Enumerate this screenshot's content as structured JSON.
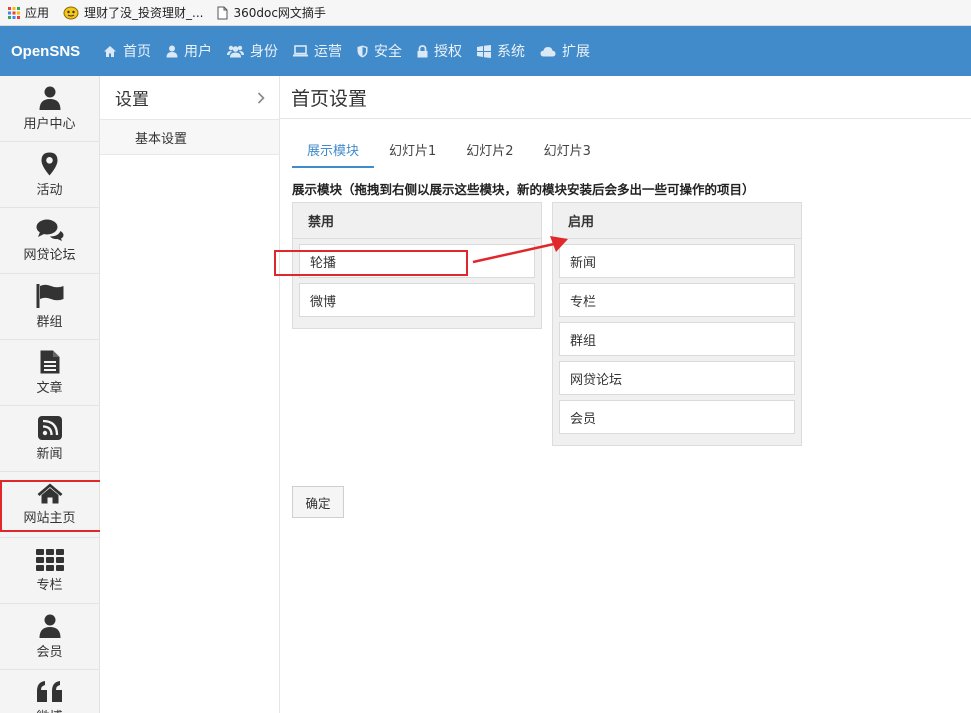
{
  "bookmarks": [
    {
      "label": "应用",
      "icon": "apps-grid-icon"
    },
    {
      "label": "理财了没_投资理财_...",
      "icon": "face-icon"
    },
    {
      "label": "360doc网文摘手",
      "icon": "document-icon"
    }
  ],
  "brand": "OpenSNS",
  "nav": [
    {
      "label": "首页",
      "icon": "home-icon"
    },
    {
      "label": "用户",
      "icon": "user-icon"
    },
    {
      "label": "身份",
      "icon": "users-icon"
    },
    {
      "label": "运营",
      "icon": "monitor-icon"
    },
    {
      "label": "安全",
      "icon": "shield-icon"
    },
    {
      "label": "授权",
      "icon": "lock-icon"
    },
    {
      "label": "系统",
      "icon": "windows-icon"
    },
    {
      "label": "扩展",
      "icon": "cloud-icon"
    }
  ],
  "leftbar": [
    {
      "label": "用户中心",
      "icon": "user-icon"
    },
    {
      "label": "活动",
      "icon": "map-marker-icon"
    },
    {
      "label": "网贷论坛",
      "icon": "comments-icon"
    },
    {
      "label": "群组",
      "icon": "flag-icon"
    },
    {
      "label": "文章",
      "icon": "file-text-icon"
    },
    {
      "label": "新闻",
      "icon": "rss-icon"
    },
    {
      "label": "网站主页",
      "icon": "home-icon",
      "active": true
    },
    {
      "label": "专栏",
      "icon": "grid-icon"
    },
    {
      "label": "会员",
      "icon": "user-icon"
    },
    {
      "label": "微博",
      "icon": "quote-icon"
    }
  ],
  "subbar": {
    "title": "设置",
    "items": [
      "基本设置"
    ]
  },
  "main": {
    "title": "首页设置",
    "tabs": [
      "展示模块",
      "幻灯片1",
      "幻灯片2",
      "幻灯片3"
    ],
    "active_tab": 0,
    "description": "展示模块（拖拽到右侧以展示这些模块，新的模块安装后会多出一些可操作的项目）",
    "disabled_panel": {
      "title": "禁用",
      "items": [
        "轮播",
        "微博"
      ]
    },
    "enabled_panel": {
      "title": "启用",
      "items": [
        "新闻",
        "专栏",
        "群组",
        "网贷论坛",
        "会员"
      ]
    },
    "confirm_label": "确定"
  },
  "colors": {
    "nav_bg": "#428bca",
    "accent": "#428bca",
    "annotation": "#e0282b"
  }
}
